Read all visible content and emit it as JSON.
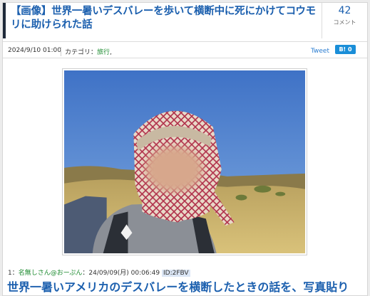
{
  "article": {
    "title": "【画像】世界一暑いデスバレーを歩いて横断中に死にかけてコウモリに助けられた話",
    "comment_count": "42",
    "comment_label": "コメント"
  },
  "meta": {
    "date": "2024/9/10 01:00",
    "category_prefix": "カテゴリ：",
    "category": "旅行",
    "category_suffix": ",",
    "tweet_label": "Tweet",
    "hatena_label": "B! 0"
  },
  "post": {
    "number": "1：",
    "name": "名無しさん@おーぷん",
    "datetime": "：24/09/09(月) 00:06:49",
    "id": "ID:2FBV",
    "text": "世界一暑いアメリカのデスバレーを横断したときの話を、写真貼り"
  },
  "colors": {
    "link_blue": "#1b5fae",
    "category_green": "#1b8a2e",
    "hatena_blue": "#1a8ed8",
    "header_accent": "#1f2a3a"
  }
}
